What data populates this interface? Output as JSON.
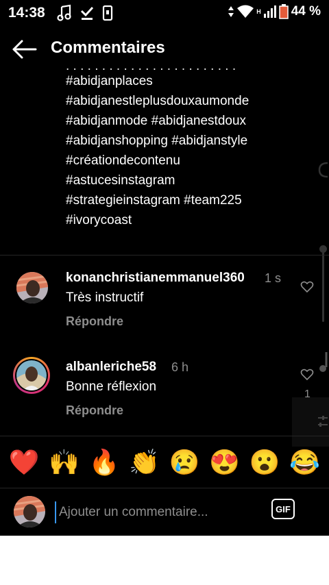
{
  "status_bar": {
    "time": "14:38",
    "network_label": "H",
    "battery": "44 %"
  },
  "header": {
    "title": "Commentaires",
    "back_icon": "arrow-left-icon"
  },
  "caption": {
    "lines": [
      "#abidjanplaces",
      "#abidjanestleplusdouxaumonde",
      "#abidjanmode #abidjanestdoux",
      "#abidjanshopping #abidjanstyle",
      "#créationdecontenu",
      "#astucesinstagram",
      "#strategieinstagram #team225",
      "#ivorycoast"
    ]
  },
  "comments": [
    {
      "username": "konanchristianemmanuel360",
      "time": "1 s",
      "text": "Très instructif",
      "reply_label": "Répondre"
    },
    {
      "username": "albanleriche58",
      "time": "6 h",
      "text": "Bonne réflexion",
      "reply_label": "Répondre",
      "likes": "1"
    }
  ],
  "reactions": [
    "❤️",
    "🙌",
    "🔥",
    "👏",
    "😢",
    "😍",
    "😮",
    "😂"
  ],
  "composer": {
    "placeholder": "Ajouter un commentaire...",
    "gif_label": "GIF"
  },
  "colors": {
    "background": "#000000",
    "secondary_text": "#8e8e8e",
    "divider": "#262626",
    "heart_red": "#ed4956"
  }
}
